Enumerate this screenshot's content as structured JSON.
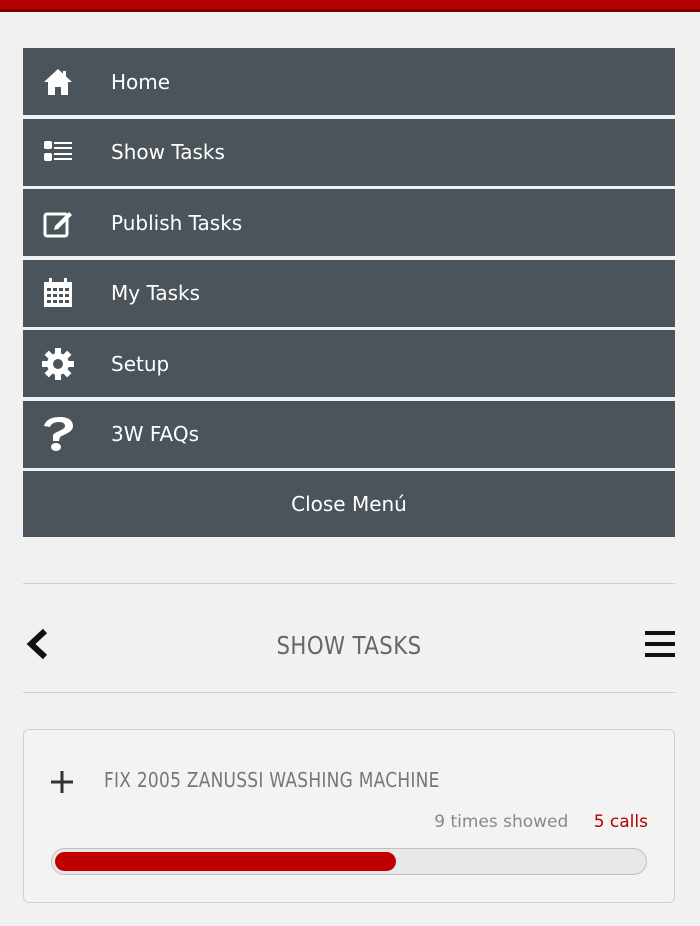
{
  "menu": {
    "items": [
      {
        "label": "Home",
        "icon": "home-icon"
      },
      {
        "label": "Show Tasks",
        "icon": "list-icon"
      },
      {
        "label": "Publish Tasks",
        "icon": "edit-icon"
      },
      {
        "label": "My Tasks",
        "icon": "calendar-icon"
      },
      {
        "label": "Setup",
        "icon": "gear-icon"
      },
      {
        "label": "3W FAQs",
        "icon": "question-icon"
      }
    ],
    "close_label": "Close Menú"
  },
  "header": {
    "title": "SHOW TASKS",
    "back_icon": "chevron-left-icon",
    "menu_icon": "hamburger-icon"
  },
  "task": {
    "title": "FIX 2005 ZANUSSI WASHING MACHINE",
    "views": "9 times showed",
    "calls": "5 calls",
    "progress_fraction": 0.58
  },
  "colors": {
    "accent": "#b30000",
    "menu_bg": "#4b545a",
    "background": "#f1f1f1"
  }
}
